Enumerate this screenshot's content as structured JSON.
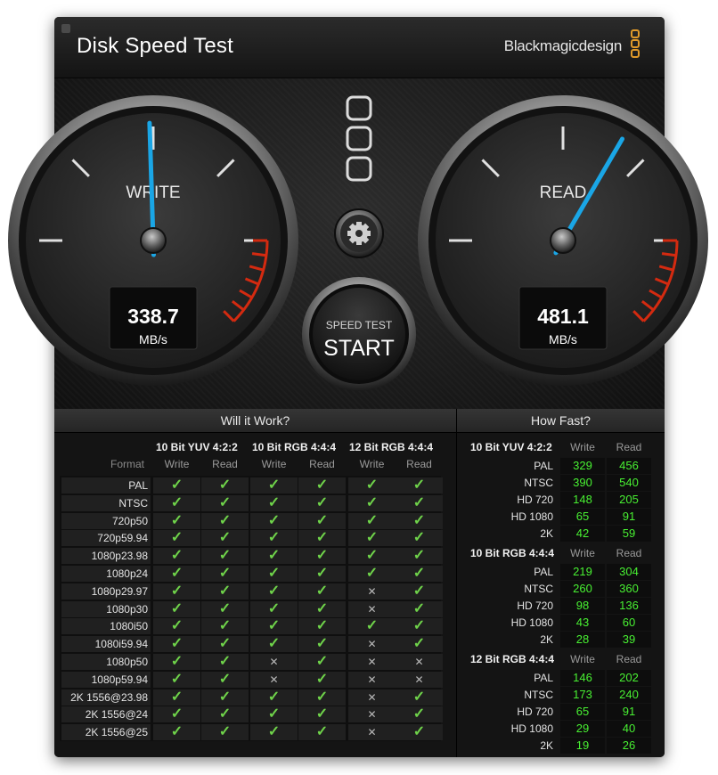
{
  "window": {
    "title": "Disk Speed Test",
    "brand": "Blackmagicdesign"
  },
  "colors": {
    "needle": "#1aa6e6",
    "ok_check": "#6fd34a",
    "speed_value": "#48f032",
    "brand_orange": "#e09a2a",
    "redline": "#d42a10"
  },
  "write_gauge": {
    "label": "WRITE",
    "value": "338.7",
    "unit": "MB/s"
  },
  "read_gauge": {
    "label": "READ",
    "value": "481.1",
    "unit": "MB/s"
  },
  "start_button": {
    "line1": "SPEED TEST",
    "line2": "START"
  },
  "icons": {
    "settings": "gear-icon",
    "brand_mark": "blackmagic-squares-icon",
    "ok": "checkmark-icon",
    "no": "cross-icon"
  },
  "will_it_work": {
    "heading": "Will it Work?",
    "format_label": "Format",
    "groups": [
      "10 Bit YUV 4:2:2",
      "10 Bit RGB 4:4:4",
      "12 Bit RGB 4:4:4"
    ],
    "sub_labels": [
      "Write",
      "Read"
    ],
    "rows": [
      {
        "format": "PAL",
        "cells": [
          1,
          1,
          1,
          1,
          1,
          1
        ]
      },
      {
        "format": "NTSC",
        "cells": [
          1,
          1,
          1,
          1,
          1,
          1
        ]
      },
      {
        "format": "720p50",
        "cells": [
          1,
          1,
          1,
          1,
          1,
          1
        ]
      },
      {
        "format": "720p59.94",
        "cells": [
          1,
          1,
          1,
          1,
          1,
          1
        ]
      },
      {
        "format": "1080p23.98",
        "cells": [
          1,
          1,
          1,
          1,
          1,
          1
        ]
      },
      {
        "format": "1080p24",
        "cells": [
          1,
          1,
          1,
          1,
          1,
          1
        ]
      },
      {
        "format": "1080p29.97",
        "cells": [
          1,
          1,
          1,
          1,
          0,
          1
        ]
      },
      {
        "format": "1080p30",
        "cells": [
          1,
          1,
          1,
          1,
          0,
          1
        ]
      },
      {
        "format": "1080i50",
        "cells": [
          1,
          1,
          1,
          1,
          1,
          1
        ]
      },
      {
        "format": "1080i59.94",
        "cells": [
          1,
          1,
          1,
          1,
          0,
          1
        ]
      },
      {
        "format": "1080p50",
        "cells": [
          1,
          1,
          0,
          1,
          0,
          0
        ]
      },
      {
        "format": "1080p59.94",
        "cells": [
          1,
          1,
          0,
          1,
          0,
          0
        ]
      },
      {
        "format": "2K 1556@23.98",
        "cells": [
          1,
          1,
          1,
          1,
          0,
          1
        ]
      },
      {
        "format": "2K 1556@24",
        "cells": [
          1,
          1,
          1,
          1,
          0,
          1
        ]
      },
      {
        "format": "2K 1556@25",
        "cells": [
          1,
          1,
          1,
          1,
          0,
          1
        ]
      }
    ]
  },
  "how_fast": {
    "heading": "How Fast?",
    "sub_labels": [
      "Write",
      "Read"
    ],
    "groups": [
      {
        "name": "10 Bit YUV 4:2:2",
        "rows": [
          {
            "format": "PAL",
            "write": "329",
            "read": "456"
          },
          {
            "format": "NTSC",
            "write": "390",
            "read": "540"
          },
          {
            "format": "HD 720",
            "write": "148",
            "read": "205"
          },
          {
            "format": "HD 1080",
            "write": "65",
            "read": "91"
          },
          {
            "format": "2K",
            "write": "42",
            "read": "59"
          }
        ]
      },
      {
        "name": "10 Bit RGB 4:4:4",
        "rows": [
          {
            "format": "PAL",
            "write": "219",
            "read": "304"
          },
          {
            "format": "NTSC",
            "write": "260",
            "read": "360"
          },
          {
            "format": "HD 720",
            "write": "98",
            "read": "136"
          },
          {
            "format": "HD 1080",
            "write": "43",
            "read": "60"
          },
          {
            "format": "2K",
            "write": "28",
            "read": "39"
          }
        ]
      },
      {
        "name": "12 Bit RGB 4:4:4",
        "rows": [
          {
            "format": "PAL",
            "write": "146",
            "read": "202"
          },
          {
            "format": "NTSC",
            "write": "173",
            "read": "240"
          },
          {
            "format": "HD 720",
            "write": "65",
            "read": "91"
          },
          {
            "format": "HD 1080",
            "write": "29",
            "read": "40"
          },
          {
            "format": "2K",
            "write": "19",
            "read": "26"
          }
        ]
      }
    ]
  }
}
